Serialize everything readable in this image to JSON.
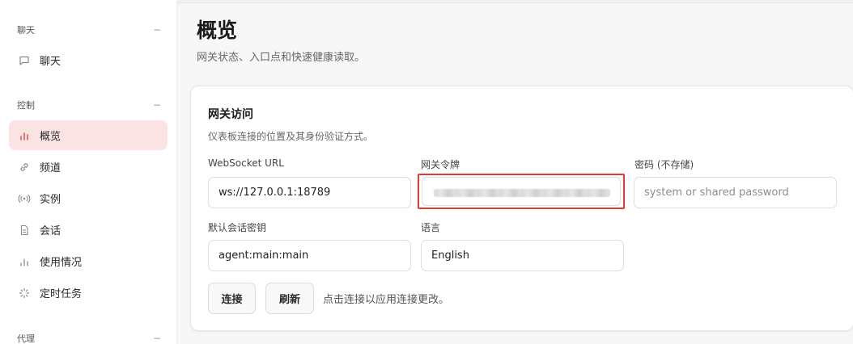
{
  "sidebar": {
    "sections": [
      {
        "header": "聊天",
        "collapse": "−"
      },
      {
        "header": "控制",
        "collapse": "−"
      },
      {
        "header": "代理",
        "collapse": "−"
      }
    ],
    "items": [
      {
        "label": "聊天",
        "icon": "chat-bubble-icon"
      },
      {
        "label": "概览",
        "icon": "bar-chart-icon",
        "active": true
      },
      {
        "label": "频道",
        "icon": "link-icon"
      },
      {
        "label": "实例",
        "icon": "radio-signal-icon"
      },
      {
        "label": "会话",
        "icon": "document-icon"
      },
      {
        "label": "使用情况",
        "icon": "bar-chart-icon"
      },
      {
        "label": "定时任务",
        "icon": "loader-icon"
      }
    ]
  },
  "main": {
    "title": "概览",
    "subtitle": "网关状态、入口点和快速健康读取。",
    "card": {
      "title": "网关访问",
      "description": "仪表板连接的位置及其身份验证方式。",
      "fields": {
        "websocket_url": {
          "label": "WebSocket URL",
          "value": "ws://127.0.0.1:18789"
        },
        "gateway_token": {
          "label": "网关令牌",
          "value": ""
        },
        "password": {
          "label": "密码 (不存储)",
          "placeholder": "system or shared password"
        },
        "session_key": {
          "label": "默认会话密钥",
          "value": "agent:main:main"
        },
        "language": {
          "label": "语言",
          "value": "English"
        }
      },
      "buttons": {
        "connect": "连接",
        "refresh": "刷新"
      },
      "hint": "点击连接以应用连接更改。"
    }
  },
  "colors": {
    "accent": "#d9483b",
    "active_bg": "#fbe3e3",
    "highlight_border": "#e23a2f"
  }
}
